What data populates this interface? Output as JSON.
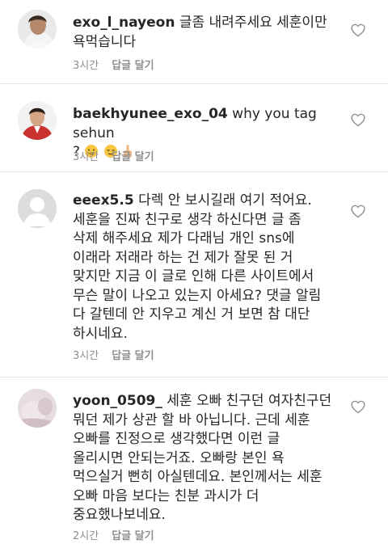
{
  "comments": [
    {
      "username": "exo_l_nayeon",
      "text": " 글좀 내려주세요 세훈이만\n욕먹습니다",
      "time": "3시간",
      "reply_label": "답글 달기",
      "avatar_icon": "profile-photo-icon"
    },
    {
      "username": "baekhyunee_exo_04",
      "text": " why you tag sehun\n? ",
      "time": "3시간",
      "reply_label": "답글 달기",
      "emojis": [
        "slightly-smiling-emoji",
        "relieved-emoji",
        "middle-finger-emoji"
      ],
      "avatar_icon": "profile-photo-icon"
    },
    {
      "username": "eeex5.5",
      "text": " 다렉 안 보시길래 여기 적어요.\n세훈을 진짜 친구로 생각 하신다면 글 좀\n삭제 해주세요 제가 다래님 개인 sns에\n이래라 저래라 하는 건 제가 잘못 된 거\n맞지만 지금 이 글로 인해 다른 사이트에서\n무슨 말이 나오고 있는지 아세요? 댓글 알림\n다 갈텐데 안 지우고 계신 거 보면 참 대단\n하시네요.",
      "time": "3시간",
      "reply_label": "답글 달기",
      "avatar_icon": "default-avatar-icon"
    },
    {
      "username": "yoon_0509_",
      "text": " 세훈 오빠 친구던 여자친구던\n뭐던 제가 상관 할 바 아닙니다. 근데 세훈\n오빠를 진정으로 생각했다면 이런 글\n올리시면 안되는거죠. 오빠랑 본인 욕\n먹으실거 뻔히 아실텐데요. 본인께서는 세훈\n오빠 마음 보다는 친분 과시가 더\n중요했나보네요.",
      "time": "2시간",
      "reply_label": "답글 달기",
      "avatar_icon": "profile-photo-icon"
    }
  ],
  "colors": {
    "text": "#262626",
    "meta": "#8e8e8e",
    "divider": "#e6e6e6"
  }
}
